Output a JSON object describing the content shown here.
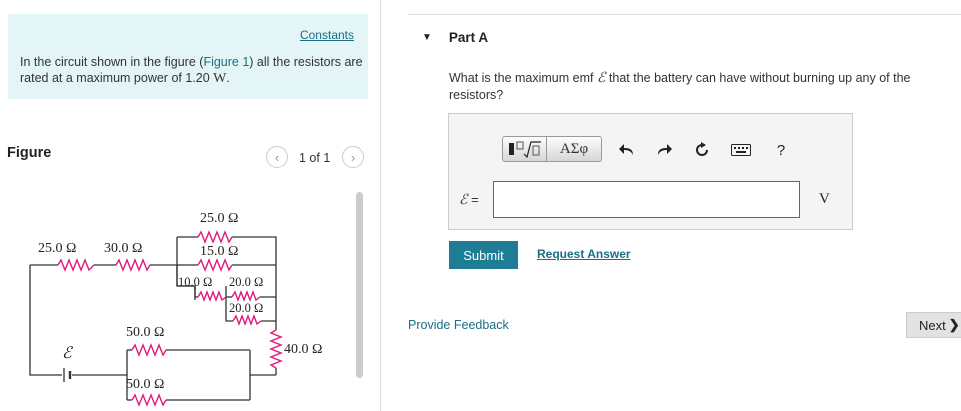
{
  "constants": {
    "link_label": "Constants",
    "intro_before": "In the circuit shown in the figure (",
    "figure_link": "Figure 1",
    "intro_middle": ") all the resistors are rated at a maximum power of 1.20 ",
    "intro_unit": "W",
    "intro_end": "."
  },
  "figure": {
    "title": "Figure",
    "counter": "1 of 1",
    "prev_icon": "chevron-left-icon",
    "next_icon": "chevron-right-icon"
  },
  "circuit": {
    "r_top_left": "25.0 Ω",
    "r_top_mid": "30.0 Ω",
    "r_top_upper": "25.0 Ω",
    "r_top_lower": "15.0 Ω",
    "r_inner_a": "10.0 Ω",
    "r_inner_b": "20.0 Ω",
    "r_inner_c": "20.0 Ω",
    "r_mid_upper": "50.0 Ω",
    "r_mid_lower": "50.0 Ω",
    "r_right": "40.0 Ω",
    "emf_label": "ℰ",
    "resistor_color": "#e0197a",
    "wire_color": "#333333"
  },
  "part": {
    "title": "Part A",
    "question_before": "What is the maximum emf ",
    "question_symbol": "ℰ",
    "question_after": " that the battery can have without burning up any of the resistors?"
  },
  "toolbar": {
    "templates_icon": "templates-icon",
    "greek_label": "ΑΣφ",
    "undo_icon": "undo-icon",
    "redo_icon": "redo-icon",
    "reset_icon": "reset-icon",
    "keyboard_icon": "keyboard-icon",
    "help_label": "?"
  },
  "answer": {
    "label_symbol": "ℰ",
    "label_eq": " =",
    "value": "",
    "unit": "V"
  },
  "actions": {
    "submit_label": "Submit",
    "request_label": "Request Answer",
    "feedback_label": "Provide Feedback",
    "next_label": "Next",
    "next_chevron": "❯"
  }
}
